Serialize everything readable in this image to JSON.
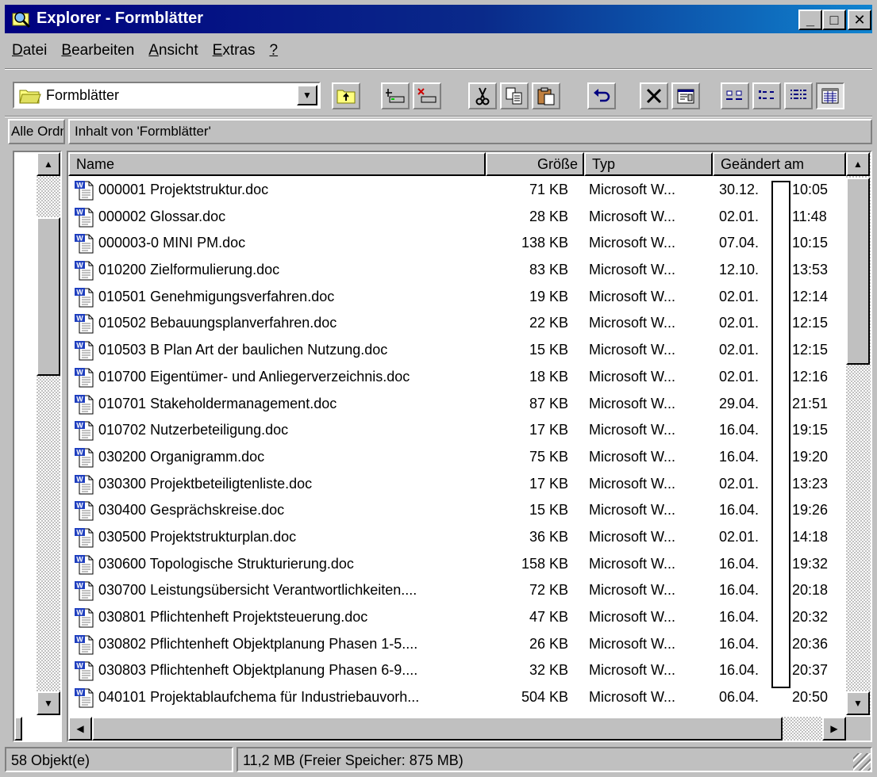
{
  "window": {
    "title": "Explorer - Formblätter",
    "minimize_glyph": "_",
    "maximize_glyph": "□",
    "close_glyph": "✕"
  },
  "menu": [
    {
      "pre": "",
      "acc": "D",
      "post": "atei"
    },
    {
      "pre": "",
      "acc": "B",
      "post": "earbeiten"
    },
    {
      "pre": "",
      "acc": "A",
      "post": "nsicht"
    },
    {
      "pre": "",
      "acc": "E",
      "post": "xtras"
    },
    {
      "pre": "",
      "acc": "?",
      "post": ""
    }
  ],
  "toolbar": {
    "address_value": "Formblätter",
    "icons": [
      "up-folder-icon",
      "map-drive-icon",
      "disconnect-drive-icon",
      "cut-icon",
      "copy-icon",
      "paste-icon",
      "undo-icon",
      "delete-icon",
      "properties-icon",
      "large-icons-view-icon",
      "small-icons-view-icon",
      "list-view-icon",
      "details-view-icon"
    ]
  },
  "panes": {
    "left_header": "Alle Ordner",
    "right_header": "Inhalt von 'Formblätter'"
  },
  "columns": {
    "name": "Name",
    "size": "Größe",
    "type": "Typ",
    "modified": "Geändert am"
  },
  "files": [
    {
      "name": "000001 Projektstruktur.doc",
      "size": "71 KB",
      "type": "Microsoft W...",
      "date": "30.12.",
      "time": "10:05"
    },
    {
      "name": "000002 Glossar.doc",
      "size": "28 KB",
      "type": "Microsoft W...",
      "date": "02.01.",
      "time": "11:48"
    },
    {
      "name": "000003-0 MINI PM.doc",
      "size": "138 KB",
      "type": "Microsoft W...",
      "date": "07.04.",
      "time": "10:15"
    },
    {
      "name": "010200 Zielformulierung.doc",
      "size": "83 KB",
      "type": "Microsoft W...",
      "date": "12.10.",
      "time": "13:53"
    },
    {
      "name": "010501 Genehmigungsverfahren.doc",
      "size": "19 KB",
      "type": "Microsoft W...",
      "date": "02.01.",
      "time": "12:14"
    },
    {
      "name": "010502 Bebauungsplanverfahren.doc",
      "size": "22 KB",
      "type": "Microsoft W...",
      "date": "02.01.",
      "time": "12:15"
    },
    {
      "name": "010503 B Plan Art der baulichen Nutzung.doc",
      "size": "15 KB",
      "type": "Microsoft W...",
      "date": "02.01.",
      "time": "12:15"
    },
    {
      "name": "010700 Eigentümer- und Anliegerverzeichnis.doc",
      "size": "18 KB",
      "type": "Microsoft W...",
      "date": "02.01.",
      "time": "12:16"
    },
    {
      "name": "010701 Stakeholdermanagement.doc",
      "size": "87 KB",
      "type": "Microsoft W...",
      "date": "29.04.",
      "time": "21:51"
    },
    {
      "name": "010702 Nutzerbeteiligung.doc",
      "size": "17 KB",
      "type": "Microsoft W...",
      "date": "16.04.",
      "time": "19:15"
    },
    {
      "name": "030200 Organigramm.doc",
      "size": "75 KB",
      "type": "Microsoft W...",
      "date": "16.04.",
      "time": "19:20"
    },
    {
      "name": "030300 Projektbeteiligtenliste.doc",
      "size": "17 KB",
      "type": "Microsoft W...",
      "date": "02.01.",
      "time": "13:23"
    },
    {
      "name": "030400 Gesprächskreise.doc",
      "size": "15 KB",
      "type": "Microsoft W...",
      "date": "16.04.",
      "time": "19:26"
    },
    {
      "name": "030500 Projektstrukturplan.doc",
      "size": "36 KB",
      "type": "Microsoft W...",
      "date": "02.01.",
      "time": "14:18"
    },
    {
      "name": "030600 Topologische Strukturierung.doc",
      "size": "158 KB",
      "type": "Microsoft W...",
      "date": "16.04.",
      "time": "19:32"
    },
    {
      "name": "030700 Leistungsübersicht Verantwortlichkeiten....",
      "size": "72 KB",
      "type": "Microsoft W...",
      "date": "16.04.",
      "time": "20:18"
    },
    {
      "name": "030801 Pflichtenheft Projektsteuerung.doc",
      "size": "47 KB",
      "type": "Microsoft W...",
      "date": "16.04.",
      "time": "20:32"
    },
    {
      "name": "030802 Pflichtenheft Objektplanung Phasen 1-5....",
      "size": "26 KB",
      "type": "Microsoft W...",
      "date": "16.04.",
      "time": "20:36"
    },
    {
      "name": "030803 Pflichtenheft Objektplanung Phasen 6-9....",
      "size": "32 KB",
      "type": "Microsoft W...",
      "date": "16.04.",
      "time": "20:37"
    },
    {
      "name": "040101 Projektablaufchema für Industriebauvorh...",
      "size": "504 KB",
      "type": "Microsoft W...",
      "date": "06.04.",
      "time": "20:50"
    }
  ],
  "status": {
    "objects": "58 Objekt(e)",
    "size_info": "11,2 MB (Freier Speicher: 875 MB)"
  },
  "colors": {
    "titlebar_start": "#000080",
    "titlebar_end": "#1084d0",
    "face": "#c0c0c0",
    "word_icon_blue": "#1f3fbf"
  }
}
